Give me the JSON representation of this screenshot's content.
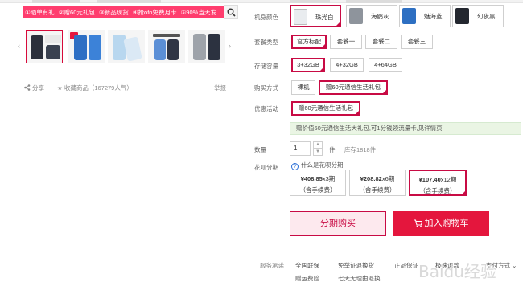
{
  "promo": {
    "items": [
      "①晒单有礼",
      "②赠60元礼包",
      "③新品现货",
      "④抢ofo免费月卡",
      "⑤90%当天发"
    ]
  },
  "gallery": {
    "prev": "‹",
    "next": "›"
  },
  "share_bar": {
    "share": "分享",
    "favorite": "收藏商品",
    "popularity": "（167279人气）",
    "report": "举报"
  },
  "specs": {
    "color": {
      "label": "机身颜色",
      "options": [
        {
          "name": "珠光白",
          "selected": true
        },
        {
          "name": "海鸥灰",
          "selected": false
        },
        {
          "name": "魅海蓝",
          "selected": false
        },
        {
          "name": "幻夜黑",
          "selected": false
        }
      ]
    },
    "package": {
      "label": "套餐类型",
      "options": [
        {
          "name": "官方标配",
          "selected": true
        },
        {
          "name": "套餐一",
          "selected": false
        },
        {
          "name": "套餐二",
          "selected": false
        },
        {
          "name": "套餐三",
          "selected": false
        }
      ]
    },
    "storage": {
      "label": "存储容量",
      "options": [
        {
          "name": "3+32GB",
          "selected": true
        },
        {
          "name": "4+32GB",
          "selected": false
        },
        {
          "name": "4+64GB",
          "selected": false
        }
      ]
    },
    "purchase": {
      "label": "购买方式",
      "options": [
        {
          "name": "裸机",
          "selected": false
        },
        {
          "name": "赠60元通信生活礼包",
          "selected": true
        }
      ]
    },
    "promotion": {
      "label": "优惠活动",
      "option": "赠60元通信生活礼包",
      "tip": "赠价值60元通信生活大礼包,可1分钱领流量卡,见详情页"
    }
  },
  "quantity": {
    "label": "数量",
    "value": "1",
    "unit": "件",
    "stock": "库存1818件",
    "up": "▲",
    "down": "▼"
  },
  "huabei": {
    "label": "花呗分期",
    "info": "什么是花呗分期",
    "info_icon": "?",
    "plans": [
      {
        "amount": "¥408.85",
        "period": "x3期",
        "note": "（含手续费）",
        "selected": false
      },
      {
        "amount": "¥208.82",
        "period": "x6期",
        "note": "（含手续费）",
        "selected": false
      },
      {
        "amount": "¥107.40",
        "period": "x12期",
        "note": "（含手续费）",
        "selected": true
      }
    ]
  },
  "actions": {
    "installment": "分期购买",
    "add_to_cart": "加入购物车"
  },
  "service": {
    "label": "服务承诺",
    "items": [
      "全国联保",
      "免举证退换货",
      "正品保证",
      "极速退款",
      "赠运费险",
      "七天无理由退换"
    ],
    "payment": "支付方式"
  },
  "watermark": "Baidu经验",
  "colors": {
    "accent": "#c80b44",
    "promo_bg": "#ff3d6e",
    "cart_bg": "#e4163d",
    "tip_bg": "#eaf5e4"
  }
}
